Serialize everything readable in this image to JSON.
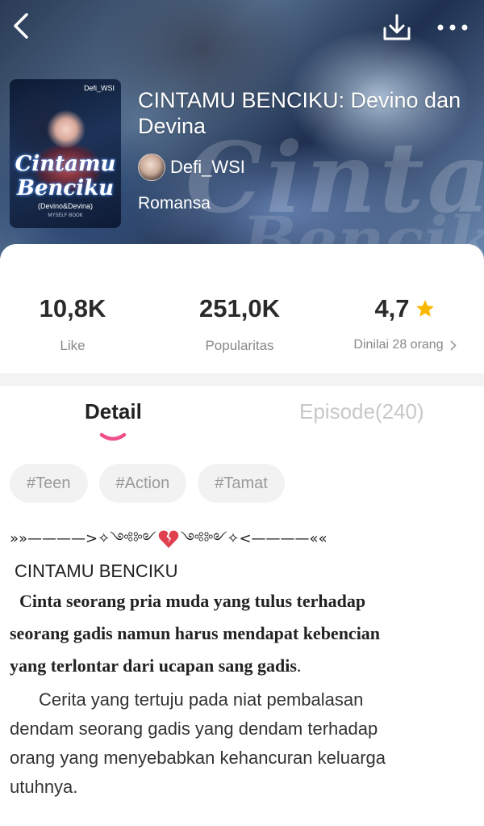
{
  "header": {
    "back_icon": "chevron-left-icon",
    "download_icon": "download-icon",
    "more_icon": "more-horizontal-icon"
  },
  "cover": {
    "author_tag": "Defi_WSI",
    "title_line1": "Cintamu",
    "title_line2": "Benciku",
    "subtitle": "(Devino&Devina)",
    "small_text": "MYSELF·BOOK"
  },
  "book": {
    "title": "CINTAMU BENCIKU: Devino dan Devina",
    "author": "Defi_WSI",
    "genre": "Romansa"
  },
  "stats": {
    "like_value": "10,8K",
    "like_label": "Like",
    "popularity_value": "251,0K",
    "popularity_label": "Popularitas",
    "rating_value": "4,7",
    "rating_label": "Dinilai 28 orang",
    "star_color": "#F9B800"
  },
  "tabs": {
    "detail": "Detail",
    "episode": "Episode(240)",
    "active": "Detail",
    "indicator_color": "#F0508A"
  },
  "tags": [
    "#Teen",
    "#Action",
    "#Tamat"
  ],
  "description": {
    "decoration_left": "»»————>✧༺༻",
    "decoration_right": "༺༻✧<————««",
    "title": "CINTAMU BENCIKU",
    "bold_line1": "Cinta seorang pria muda yang tulus terhadap",
    "bold_line2": "seorang gadis namun harus mendapat kebencian",
    "bold_line3": "yang terlontar dari ucapan sang gadis",
    "bold_line3_end": ".",
    "plain_line1": "Cerita yang tertuju pada niat pembalasan",
    "plain_line2": "dendam seorang gadis yang dendam terhadap",
    "plain_line3": "orang yang menyebabkan kehancuran keluarga",
    "plain_line4": "utuhnya."
  }
}
